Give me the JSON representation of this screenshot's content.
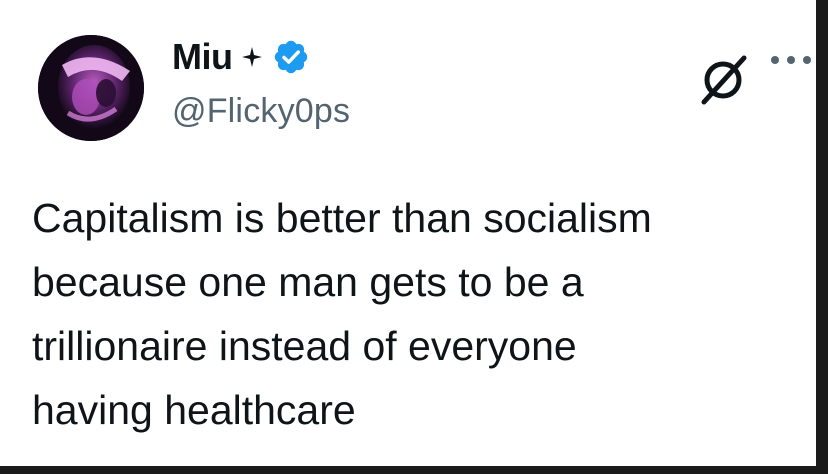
{
  "author": {
    "display_name": "Miu",
    "handle": "@Flicky0ps",
    "avatar_icon": "avatar-photo",
    "badge_icon": "verified-badge-icon",
    "badge_color": "#1d9bf0",
    "sparkle_icon": "sparkle-icon"
  },
  "actions": {
    "grok_icon": "grok-icon",
    "more_icon": "more-options-icon"
  },
  "tweet": {
    "lines": [
      "Capitalism is better than socialism",
      "because one man gets to be a",
      "trillionaire instead of everyone",
      "having healthcare"
    ]
  },
  "colors": {
    "text": "#0f1419",
    "secondary": "#536471",
    "background": "#ffffff",
    "outer": "#1b1b1b"
  }
}
